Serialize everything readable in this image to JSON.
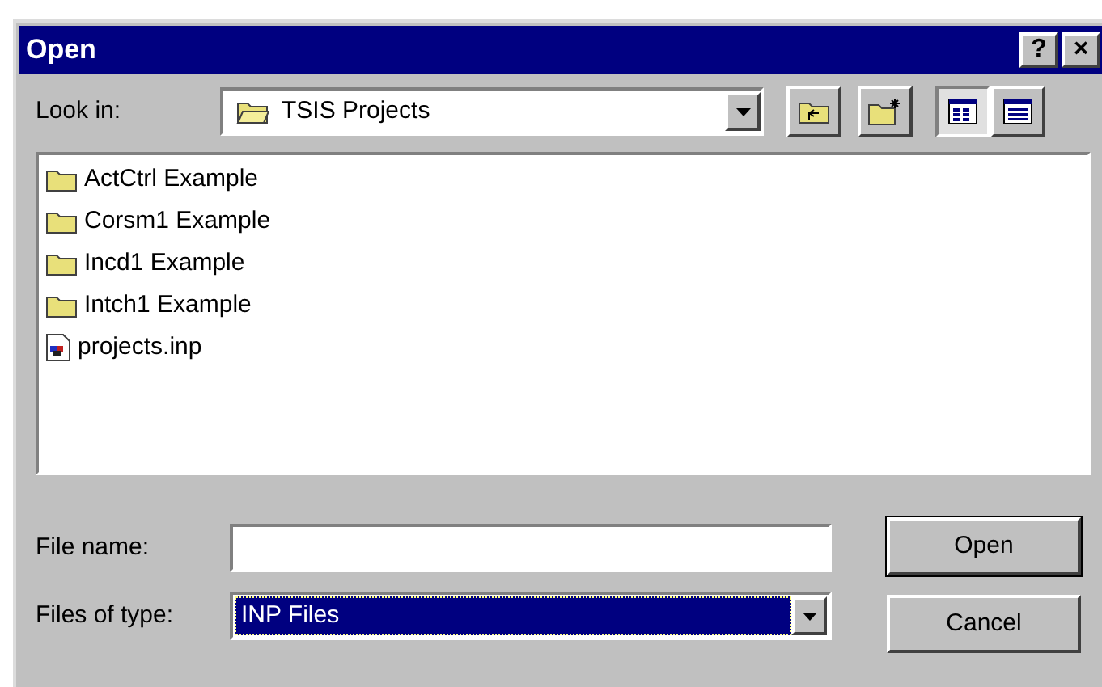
{
  "window": {
    "title": "Open",
    "title_buttons": [
      "?",
      "×"
    ]
  },
  "look_in": {
    "label": "Look in:",
    "value": "TSIS Projects"
  },
  "toolbar": [
    {
      "kind": "up-folder"
    },
    {
      "kind": "new-folder"
    }
  ],
  "views": [
    {
      "kind": "list",
      "selected": true
    },
    {
      "kind": "details",
      "selected": false
    }
  ],
  "files": [
    {
      "name": "ActCtrl Example",
      "kind": "folder"
    },
    {
      "name": "Corsm1 Example",
      "kind": "folder"
    },
    {
      "name": "Incd1 Example",
      "kind": "folder"
    },
    {
      "name": "Intch1 Example",
      "kind": "folder"
    },
    {
      "name": "projects.inp",
      "kind": "file"
    }
  ],
  "file_name": {
    "label": "File name:"
  },
  "file_type": {
    "label": "Files of type:",
    "value": "INP Files",
    "highlighted": true
  },
  "buttons": [
    {
      "label": "Open",
      "default": true
    },
    {
      "label": "Cancel",
      "default": false
    }
  ]
}
